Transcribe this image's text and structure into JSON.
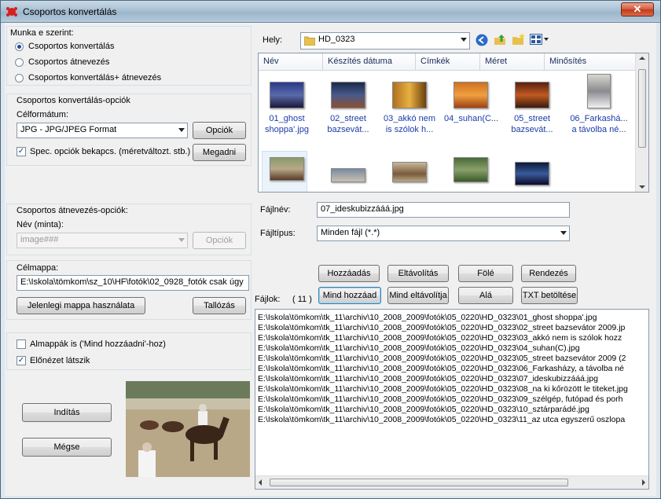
{
  "window": {
    "title": "Csoportos konvertálás",
    "close_label": "✕"
  },
  "mode": {
    "group_title": "Munka e szerint:",
    "options": [
      "Csoportos konvertálás",
      "Csoportos átnevezés",
      "Csoportos konvertálás+ átnevezés"
    ],
    "selected": 0
  },
  "convert": {
    "group_title": "Csoportos konvertálás-opciók",
    "format_label": "Célformátum:",
    "format_value": "JPG - JPG/JPEG Format",
    "options_button": "Opciók",
    "spec_check_label": "Spec. opciók bekapcs. (méretváltozt. stb.)",
    "spec_checked": true,
    "set_button": "Megadni"
  },
  "rename": {
    "group_title": "Csoportos átnevezés-opciók:",
    "name_label": "Név (minta):",
    "name_value": "image###",
    "options_button": "Opciók"
  },
  "target": {
    "label": "Célmappa:",
    "value": "E:\\Iskola\\tömkom\\sz_10\\HF\\fotók\\02_0928_fotók csak úgy",
    "use_current_button": "Jelenlegi mappa használata",
    "browse_button": "Tallózás"
  },
  "checks": {
    "subfolders_label": "Almappák is ('Mind hozzáadni'-hoz)",
    "subfolders_checked": false,
    "preview_label": "Előnézet látszik",
    "preview_checked": true
  },
  "actions": {
    "start_button": "Indítás",
    "cancel_button": "Mégse"
  },
  "location": {
    "label": "Hely:",
    "folder": "HD_0323"
  },
  "columns": [
    "Név",
    "Készítés dátuma",
    "Címkék",
    "Méret",
    "Minősítés"
  ],
  "thumbnails": [
    {
      "line1": "01_ghost",
      "line2": "shoppa'.jpg"
    },
    {
      "line1": "02_street",
      "line2": "bazsevát..."
    },
    {
      "line1": "03_akkó nem",
      "line2": "is szólok h..."
    },
    {
      "line1": "04_suhan(C...",
      "line2": ""
    },
    {
      "line1": "05_street",
      "line2": "bazsevát..."
    },
    {
      "line1": "06_Farkashá...",
      "line2": "a távolba né..."
    }
  ],
  "filename": {
    "label": "Fájlnév:",
    "value": "07_ideskubizzááá.jpg"
  },
  "filetype": {
    "label": "Fájltípus:",
    "value": "Minden fájl (*.*)"
  },
  "list_buttons": {
    "add": "Hozzáadás",
    "remove": "Eltávolítás",
    "up": "Fölé",
    "sort": "Rendezés",
    "add_all": "Mind hozzáad",
    "remove_all": "Mind eltávolítja",
    "down": "Alá",
    "load_txt": "TXT betöltése"
  },
  "files": {
    "label": "Fájlok:",
    "count": "( 11 )",
    "items": [
      "E:\\Iskola\\tömkom\\tk_11\\archiv\\10_2008_2009\\fotók\\05_0220\\HD_0323\\01_ghost shoppa'.jpg",
      "E:\\Iskola\\tömkom\\tk_11\\archiv\\10_2008_2009\\fotók\\05_0220\\HD_0323\\02_street bazsevátor 2009.jp",
      "E:\\Iskola\\tömkom\\tk_11\\archiv\\10_2008_2009\\fotók\\05_0220\\HD_0323\\03_akkó nem is szólok hozz",
      "E:\\Iskola\\tömkom\\tk_11\\archiv\\10_2008_2009\\fotók\\05_0220\\HD_0323\\04_suhan(C).jpg",
      "E:\\Iskola\\tömkom\\tk_11\\archiv\\10_2008_2009\\fotók\\05_0220\\HD_0323\\05_street bazsevátor 2009 (2",
      "E:\\Iskola\\tömkom\\tk_11\\archiv\\10_2008_2009\\fotók\\05_0220\\HD_0323\\06_Farkasházy, a távolba né",
      "E:\\Iskola\\tömkom\\tk_11\\archiv\\10_2008_2009\\fotók\\05_0220\\HD_0323\\07_ideskubizzááá.jpg",
      "E:\\Iskola\\tömkom\\tk_11\\archiv\\10_2008_2009\\fotók\\05_0220\\HD_0323\\08_na ki kőrözött le titeket.jpg",
      "E:\\Iskola\\tömkom\\tk_11\\archiv\\10_2008_2009\\fotók\\05_0220\\HD_0323\\09_szélgép, futópad és porh",
      "E:\\Iskola\\tömkom\\tk_11\\archiv\\10_2008_2009\\fotók\\05_0220\\HD_0323\\10_sztárparádé.jpg",
      "E:\\Iskola\\tömkom\\tk_11\\archiv\\10_2008_2009\\fotók\\05_0220\\HD_0323\\11_az utca egyszerű oszlopa"
    ]
  }
}
